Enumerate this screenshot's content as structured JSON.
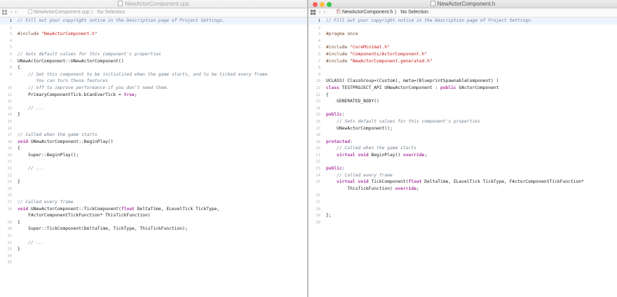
{
  "left": {
    "title": "NewActorComponent.cpp",
    "jump": "NewActorComponent.cpp 〉 No Selection",
    "current_line": 1,
    "lines": [
      [
        [
          "c",
          "// Fill out your copyright notice in the Description page of Project Settings."
        ]
      ],
      [],
      [
        [
          "p",
          "#include "
        ],
        [
          "s",
          "\"NewActorComponent.h\""
        ]
      ],
      [],
      [],
      [
        [
          "c",
          "// Sets default values for this component's properties"
        ]
      ],
      [
        [
          "t",
          "UNewActorComponent::UNewActorComponent()"
        ]
      ],
      [
        [
          "t",
          "{"
        ]
      ],
      [
        [
          "c",
          "    // Set this component to be initialized when the game starts, and to be ticked every frame."
        ]
      ],
      [
        [
          "c",
          "       You can turn these features"
        ]
      ],
      [
        [
          "c",
          "    // off to improve performance if you don't need them."
        ]
      ],
      [
        [
          "t",
          "    PrimaryComponentTick.bCanEverTick = "
        ],
        [
          "k",
          "true"
        ],
        [
          "t",
          ";"
        ]
      ],
      [],
      [
        [
          "c",
          "    // ..."
        ]
      ],
      [
        [
          "t",
          "}"
        ]
      ],
      [],
      [],
      [
        [
          "c",
          "// Called when the game starts"
        ]
      ],
      [
        [
          "k",
          "void"
        ],
        [
          "t",
          " UNewActorComponent::BeginPlay()"
        ]
      ],
      [
        [
          "t",
          "{"
        ]
      ],
      [
        [
          "t",
          "    Super::BeginPlay();"
        ]
      ],
      [],
      [
        [
          "c",
          "    // ..."
        ]
      ],
      [],
      [
        [
          "t",
          "}"
        ]
      ],
      [],
      [],
      [
        [
          "c",
          "// Called every frame"
        ]
      ],
      [
        [
          "k",
          "void"
        ],
        [
          "t",
          " UNewActorComponent::TickComponent("
        ],
        [
          "k",
          "float"
        ],
        [
          "t",
          " DeltaTime, ELevelTick TickType,"
        ]
      ],
      [
        [
          "t",
          "    FActorComponentTickFunction* ThisTickFunction)"
        ]
      ],
      [
        [
          "t",
          "{"
        ]
      ],
      [
        [
          "t",
          "    Super::TickComponent(DeltaTime, TickType, ThisTickFunction);"
        ]
      ],
      [],
      [
        [
          "c",
          "    // ..."
        ]
      ],
      [
        [
          "t",
          "}"
        ]
      ],
      [],
      []
    ],
    "numbers": [
      "1",
      "2",
      "3",
      "4",
      "5",
      "6",
      "7",
      "8",
      "9",
      "",
      "10",
      "11",
      "12",
      "13",
      "14",
      "15",
      "16",
      "17",
      "18",
      "19",
      "20",
      "21",
      "22",
      "23",
      "24",
      "25",
      "26",
      "27",
      "28",
      "",
      "29",
      "30",
      "31",
      "32",
      "33",
      "34",
      "35"
    ]
  },
  "right": {
    "title": "NewActorComponent.h",
    "jump": "NewActorComponent.h 〉 No Selection",
    "current_line": 1,
    "lines": [
      [
        [
          "c",
          "// Fill out your copyright notice in the Description page of Project Settings."
        ]
      ],
      [],
      [
        [
          "p",
          "#pragma once"
        ]
      ],
      [],
      [
        [
          "p",
          "#include "
        ],
        [
          "s",
          "\"CoreMinimal.h\""
        ]
      ],
      [
        [
          "p",
          "#include "
        ],
        [
          "s",
          "\"Components/ActorComponent.h\""
        ]
      ],
      [
        [
          "p",
          "#include "
        ],
        [
          "s",
          "\"NewActorComponent.generated.h\""
        ]
      ],
      [],
      [],
      [
        [
          "t",
          "UCLASS( ClassGroup=(Custom), meta=(BlueprintSpawnableComponent) )"
        ]
      ],
      [
        [
          "k",
          "class"
        ],
        [
          "t",
          " TESTPROJECT_API UNewActorComponent : "
        ],
        [
          "k",
          "public"
        ],
        [
          "t",
          " UActorComponent"
        ]
      ],
      [
        [
          "t",
          "{"
        ]
      ],
      [
        [
          "t",
          "    GENERATED_BODY()"
        ]
      ],
      [],
      [
        [
          "k",
          "public"
        ],
        [
          "t",
          ":"
        ]
      ],
      [
        [
          "c",
          "    // Sets default values for this component's properties"
        ]
      ],
      [
        [
          "t",
          "    UNewActorComponent();"
        ]
      ],
      [],
      [
        [
          "k",
          "protected"
        ],
        [
          "t",
          ":"
        ]
      ],
      [
        [
          "c",
          "    // Called when the game starts"
        ]
      ],
      [
        [
          "t",
          "    "
        ],
        [
          "k",
          "virtual void"
        ],
        [
          "t",
          " BeginPlay() "
        ],
        [
          "k",
          "override"
        ],
        [
          "t",
          ";"
        ]
      ],
      [],
      [
        [
          "k",
          "public"
        ],
        [
          "t",
          ":"
        ]
      ],
      [
        [
          "c",
          "    // Called every frame"
        ]
      ],
      [
        [
          "t",
          "    "
        ],
        [
          "k",
          "virtual void"
        ],
        [
          "t",
          " TickComponent("
        ],
        [
          "k",
          "float"
        ],
        [
          "t",
          " DeltaTime, ELevelTick TickType, FActorComponentTickFunction*"
        ]
      ],
      [
        [
          "t",
          "        ThisTickFunction) "
        ],
        [
          "k",
          "override"
        ],
        [
          "t",
          ";"
        ]
      ],
      [],
      [],
      [],
      [
        [
          "t",
          "};"
        ]
      ],
      []
    ],
    "numbers": [
      "1",
      "2",
      "3",
      "4",
      "5",
      "6",
      "7",
      "8",
      "9",
      "10",
      "11",
      "12",
      "13",
      "14",
      "15",
      "16",
      "17",
      "18",
      "19",
      "20",
      "21",
      "22",
      "23",
      "24",
      "25",
      "",
      "26",
      "27",
      "28",
      "29",
      "30"
    ]
  }
}
